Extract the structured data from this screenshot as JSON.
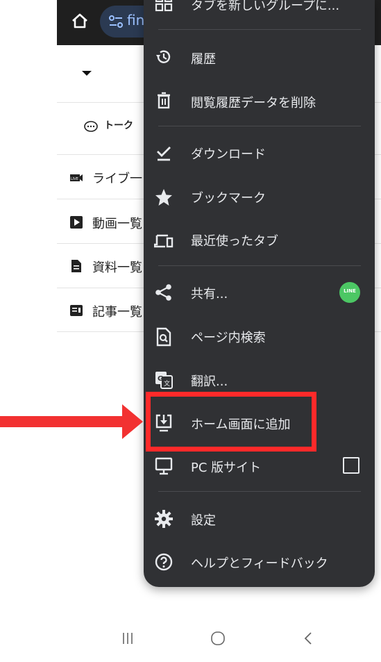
{
  "browser": {
    "url_text": "fin"
  },
  "page": {
    "talk_label": "トーク",
    "list_items": [
      {
        "label": "ライブ一",
        "icon": "live-video-icon"
      },
      {
        "label": "動画一覧",
        "icon": "play-square-icon"
      },
      {
        "label": "資料一覧",
        "icon": "document-icon"
      },
      {
        "label": "記事一覧",
        "icon": "article-icon"
      }
    ]
  },
  "menu": {
    "top_partial": "タブを新しいグループに...",
    "items": [
      {
        "label": "履歴",
        "icon": "history-icon"
      },
      {
        "label": "閲覧履歴データを削除",
        "icon": "trash-icon"
      },
      {
        "label": "ダウンロード",
        "icon": "download-check-icon"
      },
      {
        "label": "ブックマーク",
        "icon": "star-icon"
      },
      {
        "label": "最近使ったタブ",
        "icon": "devices-icon"
      },
      {
        "label": "共有...",
        "icon": "share-icon"
      },
      {
        "label": "ページ内検索",
        "icon": "find-in-page-icon"
      },
      {
        "label": "翻訳...",
        "icon": "translate-icon"
      },
      {
        "label": "ホーム画面に追加",
        "icon": "add-to-home-icon"
      },
      {
        "label": "PC 版サイト",
        "icon": "monitor-icon"
      },
      {
        "label": "設定",
        "icon": "gear-icon"
      },
      {
        "label": "ヘルプとフィードバック",
        "icon": "help-icon"
      }
    ],
    "line_badge": "LINE",
    "desktop_site_checked": false
  },
  "colors": {
    "menu_bg": "#303134",
    "highlight": "#ff2a2a",
    "line_green": "#4cc764"
  }
}
